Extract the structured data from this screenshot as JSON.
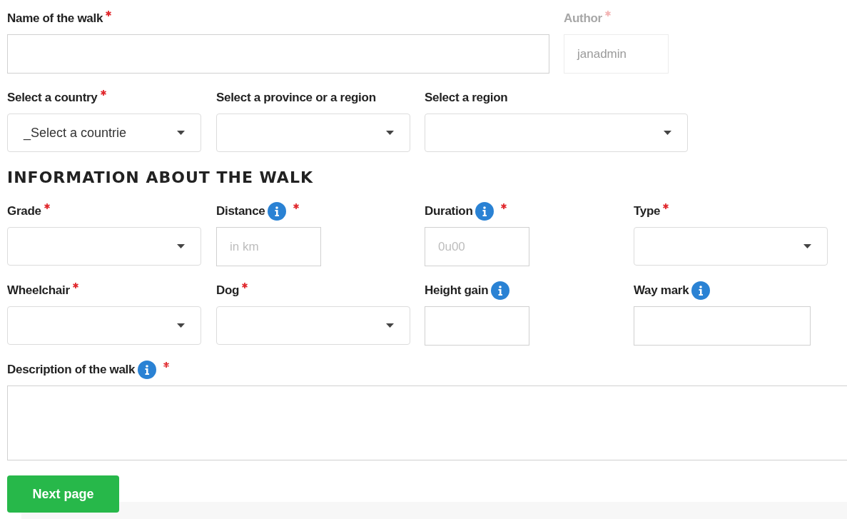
{
  "form": [
    {
      "kind": "row",
      "fields": [
        {
          "label": "Name of the walk",
          "kind": "text",
          "required": true,
          "info": false,
          "disabled": false
        },
        {
          "label": "Author",
          "kind": "text",
          "required": true,
          "info": false,
          "disabled": true,
          "value": "janadmin"
        }
      ]
    },
    {
      "kind": "row",
      "fields": [
        {
          "label": "Select a country",
          "kind": "select",
          "required": true,
          "info": false,
          "disabled": false,
          "value": "_Select a countrie"
        },
        {
          "label": "Select a province or a region",
          "kind": "select",
          "required": false,
          "info": false,
          "disabled": false
        },
        {
          "label": "Select a region",
          "kind": "select",
          "required": false,
          "info": false,
          "disabled": false
        }
      ]
    },
    {
      "kind": "heading",
      "text": "INFORMATION ABOUT THE WALK"
    },
    {
      "kind": "row",
      "fields": [
        {
          "label": "Grade",
          "kind": "select",
          "required": true,
          "info": false,
          "disabled": false
        },
        {
          "label": "Distance",
          "kind": "text",
          "required": true,
          "info": true,
          "disabled": false,
          "placeholder": "in km"
        },
        {
          "label": "Duration",
          "kind": "text",
          "required": true,
          "info": true,
          "disabled": false,
          "placeholder": "0u00"
        },
        {
          "label": "Type",
          "kind": "select",
          "required": true,
          "info": false,
          "disabled": false
        }
      ]
    },
    {
      "kind": "row",
      "fields": [
        {
          "label": "Wheelchair",
          "kind": "select",
          "required": true,
          "info": false,
          "disabled": false
        },
        {
          "label": "Dog",
          "kind": "select",
          "required": true,
          "info": false,
          "disabled": false
        },
        {
          "label": "Height gain",
          "kind": "text",
          "required": false,
          "info": true,
          "disabled": false
        },
        {
          "label": "Way mark",
          "kind": "text",
          "required": false,
          "info": true,
          "disabled": false
        }
      ]
    },
    {
      "kind": "row",
      "fields": [
        {
          "label": "Description of the walk",
          "kind": "textarea",
          "required": true,
          "info": true,
          "disabled": false
        }
      ]
    }
  ],
  "buttons": [
    {
      "label": "Next page"
    }
  ]
}
